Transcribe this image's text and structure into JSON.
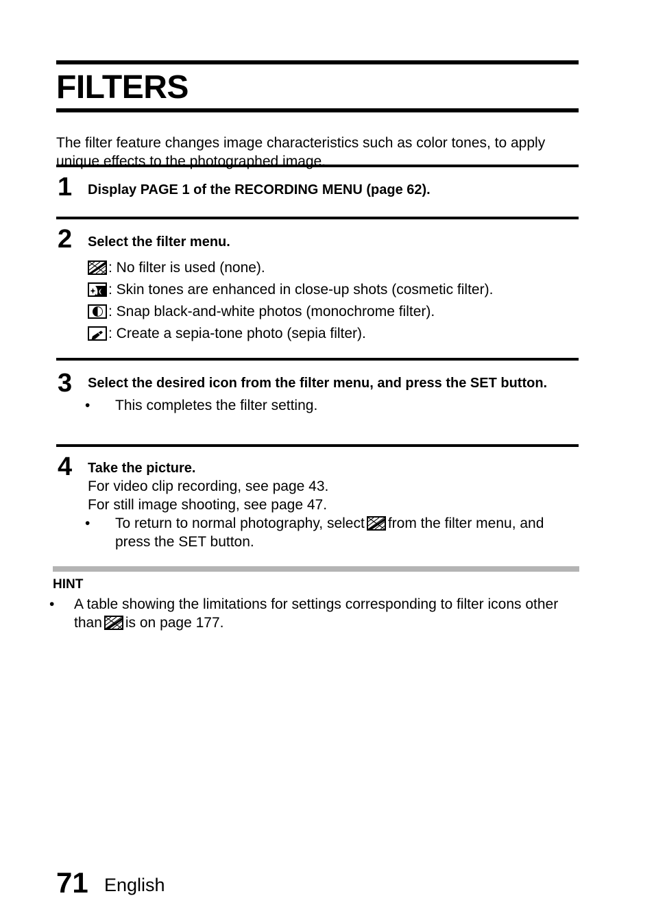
{
  "document": {
    "title": "FILTERS",
    "intro": "The filter feature changes image characteristics such as color tones, to apply unique effects to the photographed image."
  },
  "steps": [
    {
      "number": "1",
      "heading": "Display PAGE 1 of the RECORDING MENU (page 62)."
    },
    {
      "number": "2",
      "heading": "Select the filter menu.",
      "filters": [
        {
          "icon": "filter-none-icon",
          "text": ": No filter is used (none)."
        },
        {
          "icon": "filter-cosmetic-icon",
          "text": ": Skin tones are enhanced in close-up shots (cosmetic filter)."
        },
        {
          "icon": "filter-monochrome-icon",
          "text": ": Snap black-and-white photos (monochrome filter)."
        },
        {
          "icon": "filter-sepia-icon",
          "text": ": Create a sepia-tone photo (sepia filter)."
        }
      ]
    },
    {
      "number": "3",
      "heading": "Select the desired icon from the filter menu, and press the SET button.",
      "bullet": "This completes the filter setting.",
      "bullet_marker": "•"
    },
    {
      "number": "4",
      "heading": "Take the picture.",
      "line1": "For video clip recording, see page 43.",
      "line2": "For still image shooting, see page 47.",
      "bullet_marker": "•",
      "bullet_part1": "To return to normal photography, select",
      "bullet_part2": "from the filter menu, and press the SET button."
    }
  ],
  "hint": {
    "title": "HINT",
    "bullet_marker": "•",
    "part1": "A table showing the limitations for settings corresponding to filter icons other than",
    "part2": "is on page 177."
  },
  "footer": {
    "page_number": "71",
    "language": "English"
  },
  "colors": {
    "text": "#000000",
    "rule": "#000000",
    "hint_divider": "#b4b4b4",
    "background": "#ffffff"
  }
}
